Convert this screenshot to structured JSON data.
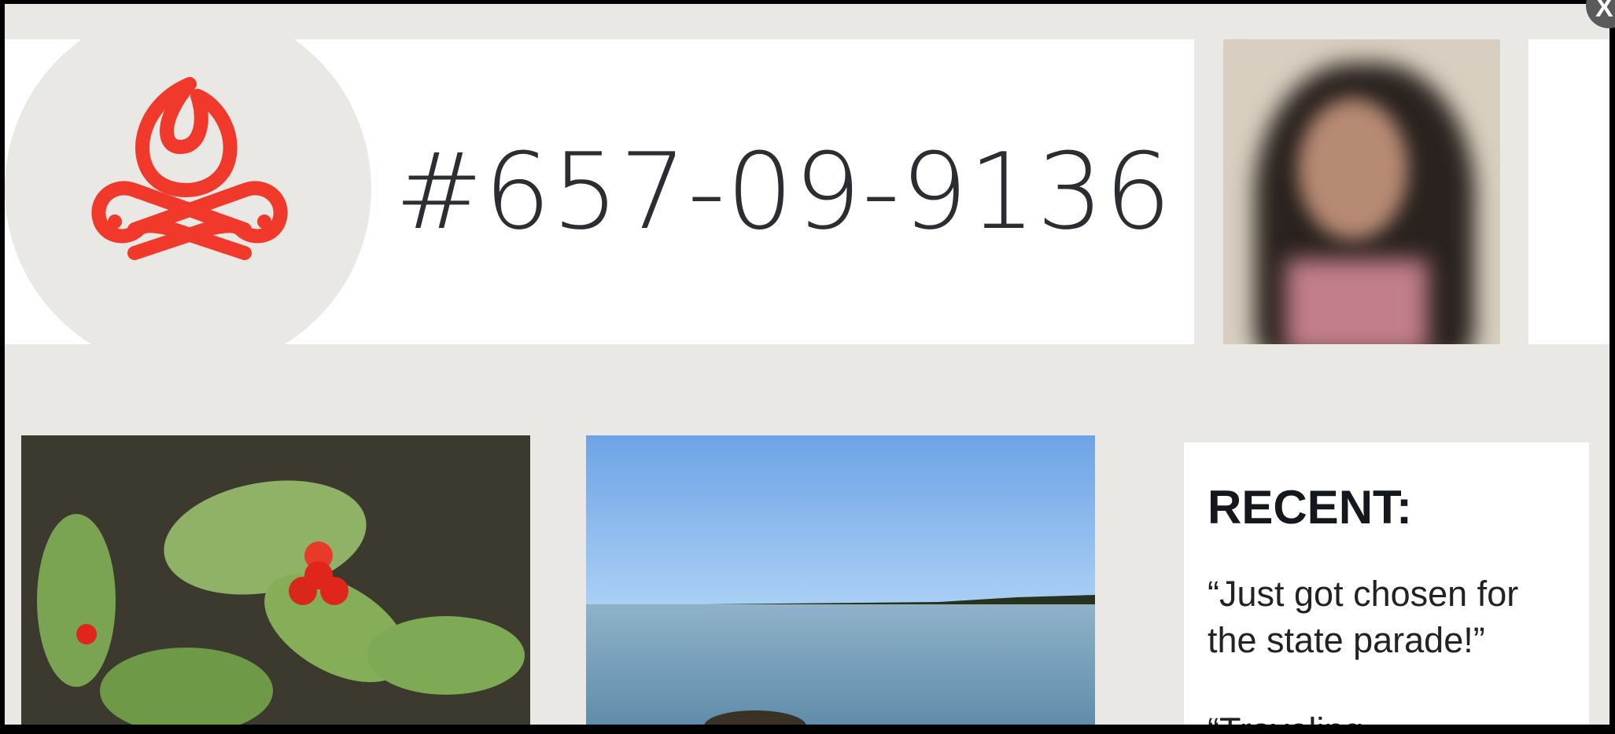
{
  "profile": {
    "id_number": "#657-09-9136",
    "icon": "campfire-icon",
    "accent_color": "#f0392a"
  },
  "recent": {
    "heading": "RECENT:",
    "posts": [
      "“Just got chosen for the state parade!”",
      "“Traveling..."
    ]
  },
  "close_label": "X"
}
